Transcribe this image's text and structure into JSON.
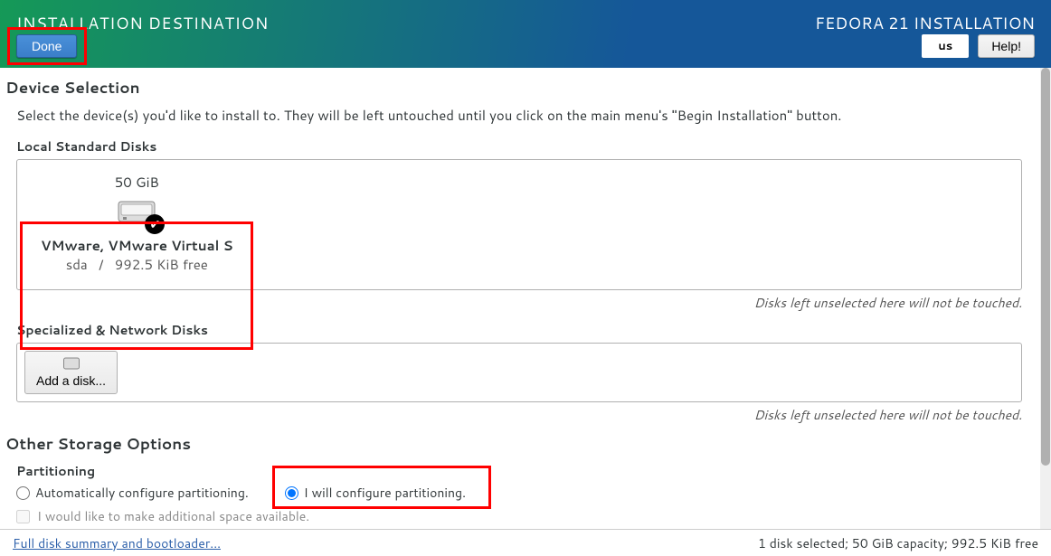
{
  "header": {
    "title": "INSTALLATION DESTINATION",
    "product": "FEDORA 21 INSTALLATION",
    "done_label": "Done",
    "help_label": "Help!",
    "lang": "us"
  },
  "device_selection": {
    "heading": "Device Selection",
    "instruction": "Select the device(s) you'd like to install to.  They will be left untouched until you click on the main menu's \"Begin Installation\" button."
  },
  "local_disks": {
    "label": "Local Standard Disks",
    "note": "Disks left unselected here will not be touched.",
    "items": [
      {
        "size": "50 GiB",
        "model": "VMware, VMware Virtual S",
        "dev": "sda",
        "sep": "/",
        "free": "992.5 KiB free"
      }
    ]
  },
  "network_disks": {
    "label": "Specialized & Network Disks",
    "add_label": "Add a disk...",
    "note": "Disks left unselected here will not be touched."
  },
  "storage_options": {
    "heading": "Other Storage Options",
    "partitioning_label": "Partitioning",
    "auto_label": "Automatically configure partitioning.",
    "manual_label": "I will configure partitioning.",
    "additional_space_label": "I would like to make additional space available."
  },
  "footer": {
    "link": "Full disk summary and bootloader...",
    "status": "1 disk selected; 50 GiB capacity; 992.5 KiB free"
  }
}
